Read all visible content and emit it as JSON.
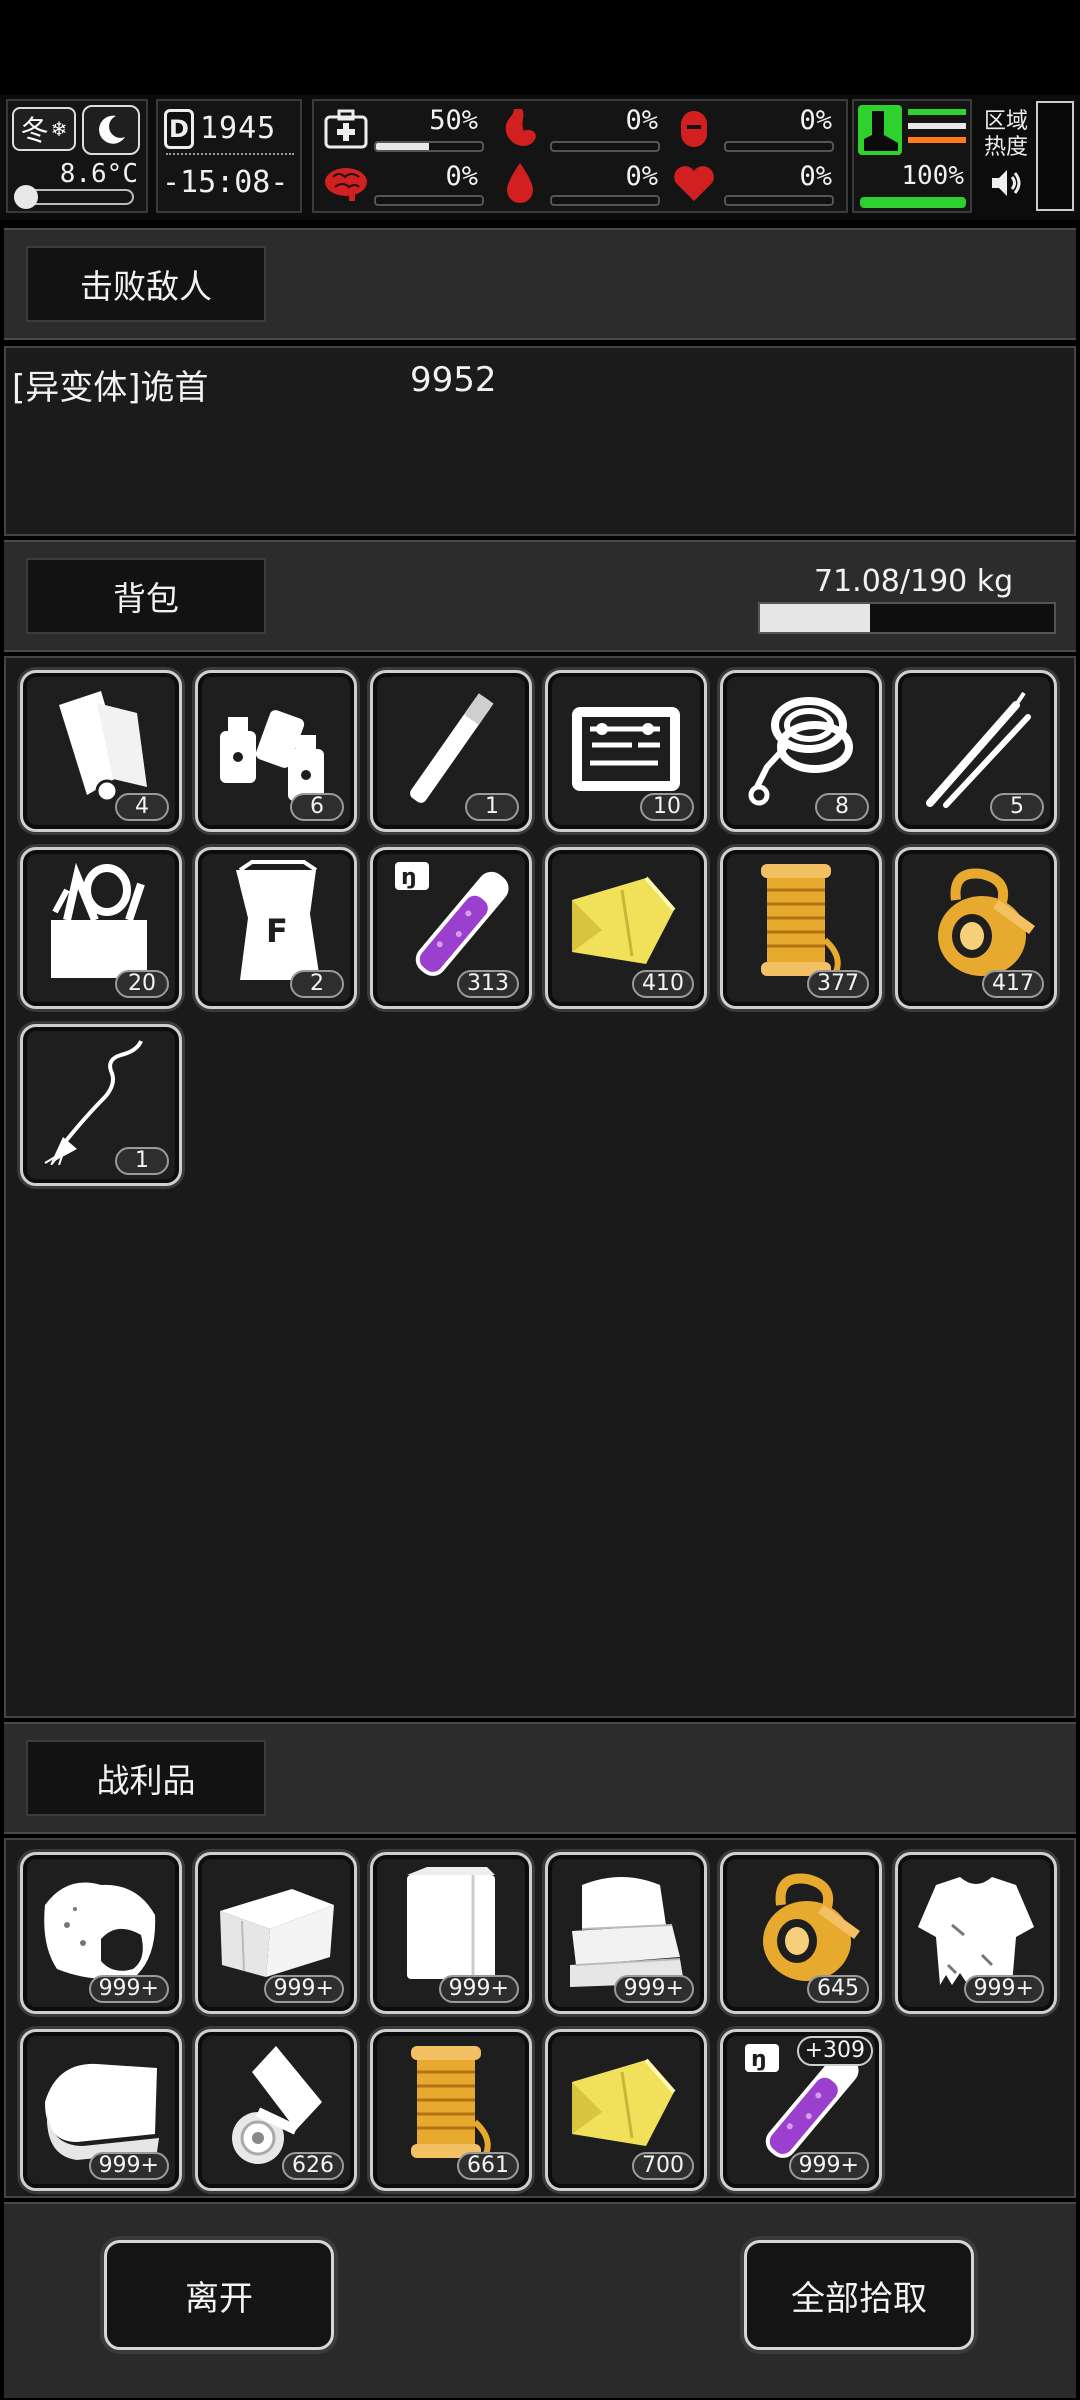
{
  "status": {
    "season": "冬",
    "temperature": "8.6°C",
    "day": "1945",
    "time": "-15:08-",
    "health_pct": "50%",
    "stomach_pct": "0%",
    "lung_pct": "0%",
    "brain_pct": "0%",
    "blood_pct": "0%",
    "heart_pct": "0%",
    "stamina_pct": "100%",
    "zone_heat_label": "区域热度",
    "bars": {
      "health": 0.5,
      "stomach": 0,
      "lung": 0,
      "brain": 0,
      "blood": 0,
      "heart": 0,
      "stamina": 1.0
    },
    "icons": [
      "winter-icon",
      "moon-icon",
      "thermometer-icon",
      "day-icon",
      "medkit-icon",
      "stomach-icon",
      "lung-icon",
      "brain-icon",
      "blood-drop-icon",
      "heart-icon",
      "boot-icon",
      "speaker-icon"
    ]
  },
  "defeated": {
    "title": "击败敌人",
    "enemy_name": "[异变体]诡首",
    "enemy_value": "9952"
  },
  "backpack": {
    "title": "背包",
    "weight": "71.08/190 kg",
    "weight_fraction": 0.374,
    "items": [
      {
        "icon": "paper-scroll-icon",
        "count": "4"
      },
      {
        "icon": "spray-bottles-icon",
        "count": "6"
      },
      {
        "icon": "cigarette-icon",
        "count": "1"
      },
      {
        "icon": "toolbox-icon",
        "count": "10"
      },
      {
        "icon": "rope-icon",
        "count": "8"
      },
      {
        "icon": "tweezers-icon",
        "count": "5"
      },
      {
        "icon": "tool-bag-icon",
        "count": "20"
      },
      {
        "icon": "flour-sack-icon",
        "count": "2"
      },
      {
        "icon": "purple-test-tube-icon",
        "count": "313"
      },
      {
        "icon": "yellow-cloth-icon",
        "count": "410"
      },
      {
        "icon": "spool-thread-icon",
        "count": "377"
      },
      {
        "icon": "tape-roll-icon",
        "count": "417"
      },
      {
        "icon": "brush-wire-icon",
        "count": "1"
      }
    ]
  },
  "loot": {
    "title": "战利品",
    "items": [
      {
        "icon": "dirt-bag-icon",
        "count": "999+"
      },
      {
        "icon": "folded-cloth-icon",
        "count": "999+"
      },
      {
        "icon": "white-sheet-icon",
        "count": "999+"
      },
      {
        "icon": "towels-icon",
        "count": "999+"
      },
      {
        "icon": "tape-roll-icon",
        "count": "645"
      },
      {
        "icon": "torn-shirt-icon",
        "count": "999+"
      },
      {
        "icon": "fabric-roll-icon",
        "count": "999+"
      },
      {
        "icon": "paper-roll-icon",
        "count": "626"
      },
      {
        "icon": "spool-thread-icon",
        "count": "661"
      },
      {
        "icon": "yellow-cloth-icon",
        "count": "700"
      },
      {
        "icon": "purple-test-tube-icon",
        "count": "999+",
        "plus": "+309"
      }
    ]
  },
  "buttons": {
    "leave": "离开",
    "take_all": "全部拾取"
  },
  "colors": {
    "accent_red": "#d21f1f",
    "accent_green": "#2fd12f",
    "accent_orange": "#ff7a1a",
    "gold": "#e7a92e",
    "yellow": "#f1e05a",
    "purple": "#9b3fcf"
  }
}
